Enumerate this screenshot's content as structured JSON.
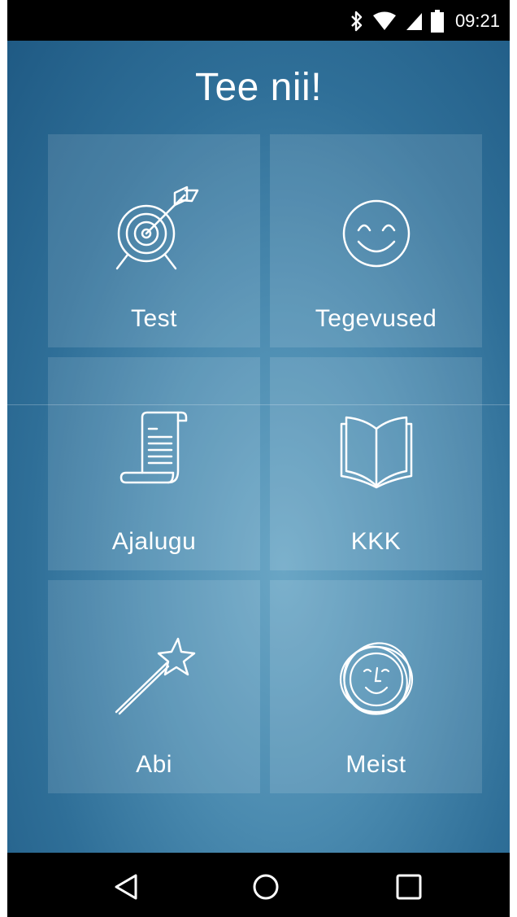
{
  "status_bar": {
    "time": "09:21",
    "icons": [
      "bluetooth-icon",
      "wifi-icon",
      "signal-icon",
      "battery-icon"
    ]
  },
  "app": {
    "title": "Tee nii!",
    "tiles": [
      {
        "label": "Test",
        "icon": "target-icon"
      },
      {
        "label": "Tegevused",
        "icon": "smiley-icon"
      },
      {
        "label": "Ajalugu",
        "icon": "scroll-icon"
      },
      {
        "label": "KKK",
        "icon": "book-icon"
      },
      {
        "label": "Abi",
        "icon": "magic-wand-icon"
      },
      {
        "label": "Meist",
        "icon": "face-logo-icon"
      }
    ]
  },
  "nav_bar": {
    "buttons": [
      "back-icon",
      "home-icon",
      "recents-icon"
    ]
  },
  "colors": {
    "background_dark": "#1f5a84",
    "background_light": "#6aa6c5",
    "tile": "rgba(255,255,255,0.12)",
    "text": "#ffffff"
  }
}
